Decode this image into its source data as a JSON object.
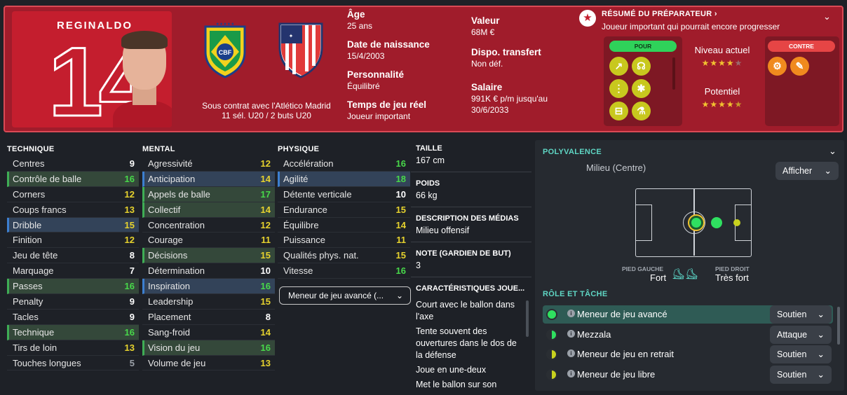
{
  "player": {
    "name": "REGINALDO",
    "number": "14"
  },
  "contract": {
    "line1": "Sous contrat avec l'Atlético Madrid",
    "line2": "11 sél. U20 / 2 buts U20",
    "cbf": "CBF"
  },
  "details_left": [
    {
      "label": "Âge",
      "value": "25 ans"
    },
    {
      "label": "Date de naissance",
      "value": "15/4/2003"
    },
    {
      "label": "Personnalité",
      "value": "Équilibré"
    },
    {
      "label": "Temps de jeu réel",
      "value": "Joueur important"
    }
  ],
  "details_right": [
    {
      "label": "Valeur",
      "value": "68M €"
    },
    {
      "label": "Dispo. transfert",
      "value": "Non déf."
    },
    {
      "label": "Salaire",
      "value": "991K € p/m jusqu'au",
      "value2": "30/6/2033"
    }
  ],
  "coach_report": {
    "title": "RÉSUMÉ DU PRÉPARATEUR ›",
    "summary": "Joueur important qui pourrait encore progresser",
    "pour": "POUR",
    "contre": "CONTRE",
    "current_label": "Niveau actuel",
    "potential_label": "Potentiel",
    "current_stars": 4,
    "potential_stars": 4.5
  },
  "technique": {
    "header": "TECHNIQUE",
    "rows": [
      {
        "name": "Centres",
        "v": "9"
      },
      {
        "name": "Contrôle de balle",
        "v": "16"
      },
      {
        "name": "Corners",
        "v": "12"
      },
      {
        "name": "Coups francs",
        "v": "13"
      },
      {
        "name": "Dribble",
        "v": "15"
      },
      {
        "name": "Finition",
        "v": "12"
      },
      {
        "name": "Jeu de tête",
        "v": "8"
      },
      {
        "name": "Marquage",
        "v": "7"
      },
      {
        "name": "Passes",
        "v": "16"
      },
      {
        "name": "Penalty",
        "v": "9"
      },
      {
        "name": "Tacles",
        "v": "9"
      },
      {
        "name": "Technique",
        "v": "16"
      },
      {
        "name": "Tirs de loin",
        "v": "13"
      },
      {
        "name": "Touches longues",
        "v": "5"
      }
    ]
  },
  "mental": {
    "header": "MENTAL",
    "rows": [
      {
        "name": "Agressivité",
        "v": "12"
      },
      {
        "name": "Anticipation",
        "v": "14"
      },
      {
        "name": "Appels de balle",
        "v": "17"
      },
      {
        "name": "Collectif",
        "v": "14"
      },
      {
        "name": "Concentration",
        "v": "12"
      },
      {
        "name": "Courage",
        "v": "11"
      },
      {
        "name": "Décisions",
        "v": "15"
      },
      {
        "name": "Détermination",
        "v": "10"
      },
      {
        "name": "Inspiration",
        "v": "16"
      },
      {
        "name": "Leadership",
        "v": "15"
      },
      {
        "name": "Placement",
        "v": "8"
      },
      {
        "name": "Sang-froid",
        "v": "14"
      },
      {
        "name": "Vision du jeu",
        "v": "16"
      },
      {
        "name": "Volume de jeu",
        "v": "13"
      }
    ]
  },
  "physique": {
    "header": "PHYSIQUE",
    "rows": [
      {
        "name": "Accélération",
        "v": "16"
      },
      {
        "name": "Agilité",
        "v": "18"
      },
      {
        "name": "Détente verticale",
        "v": "10"
      },
      {
        "name": "Endurance",
        "v": "15"
      },
      {
        "name": "Équilibre",
        "v": "14"
      },
      {
        "name": "Puissance",
        "v": "11"
      },
      {
        "name": "Qualités phys. nat.",
        "v": "15"
      },
      {
        "name": "Vitesse",
        "v": "16"
      }
    ]
  },
  "role_select": "Meneur de jeu avancé (...",
  "info": {
    "taille_h": "TAILLE",
    "taille": "167 cm",
    "poids_h": "POIDS",
    "poids": "66 kg",
    "media_h": "DESCRIPTION DES MÉDIAS",
    "media": "Milieu offensif",
    "gk_h": "NOTE (GARDIEN DE BUT)",
    "gk": "3",
    "traits_h": "CARACTÉRISTIQUES JOUE...",
    "traits": [
      "Court avec le ballon dans l'axe",
      "Tente souvent des ouvertures dans le dos de la défense",
      "Joue en une-deux",
      "Met le ballon sur son"
    ]
  },
  "polyvalence": {
    "header": "POLYVALENCE",
    "position": "Milieu (Centre)",
    "show_btn": "Afficher",
    "left_foot_label": "PIED GAUCHE",
    "left_foot": "Fort",
    "right_foot_label": "PIED DROIT",
    "right_foot": "Très fort"
  },
  "roles": {
    "header": "RÔLE ET TÂCHE",
    "items": [
      {
        "name": "Meneur de jeu avancé",
        "duty": "Soutien"
      },
      {
        "name": "Mezzala",
        "duty": "Attaque"
      },
      {
        "name": "Meneur de jeu en retrait",
        "duty": "Soutien"
      },
      {
        "name": "Meneur de jeu libre",
        "duty": "Soutien"
      }
    ]
  }
}
